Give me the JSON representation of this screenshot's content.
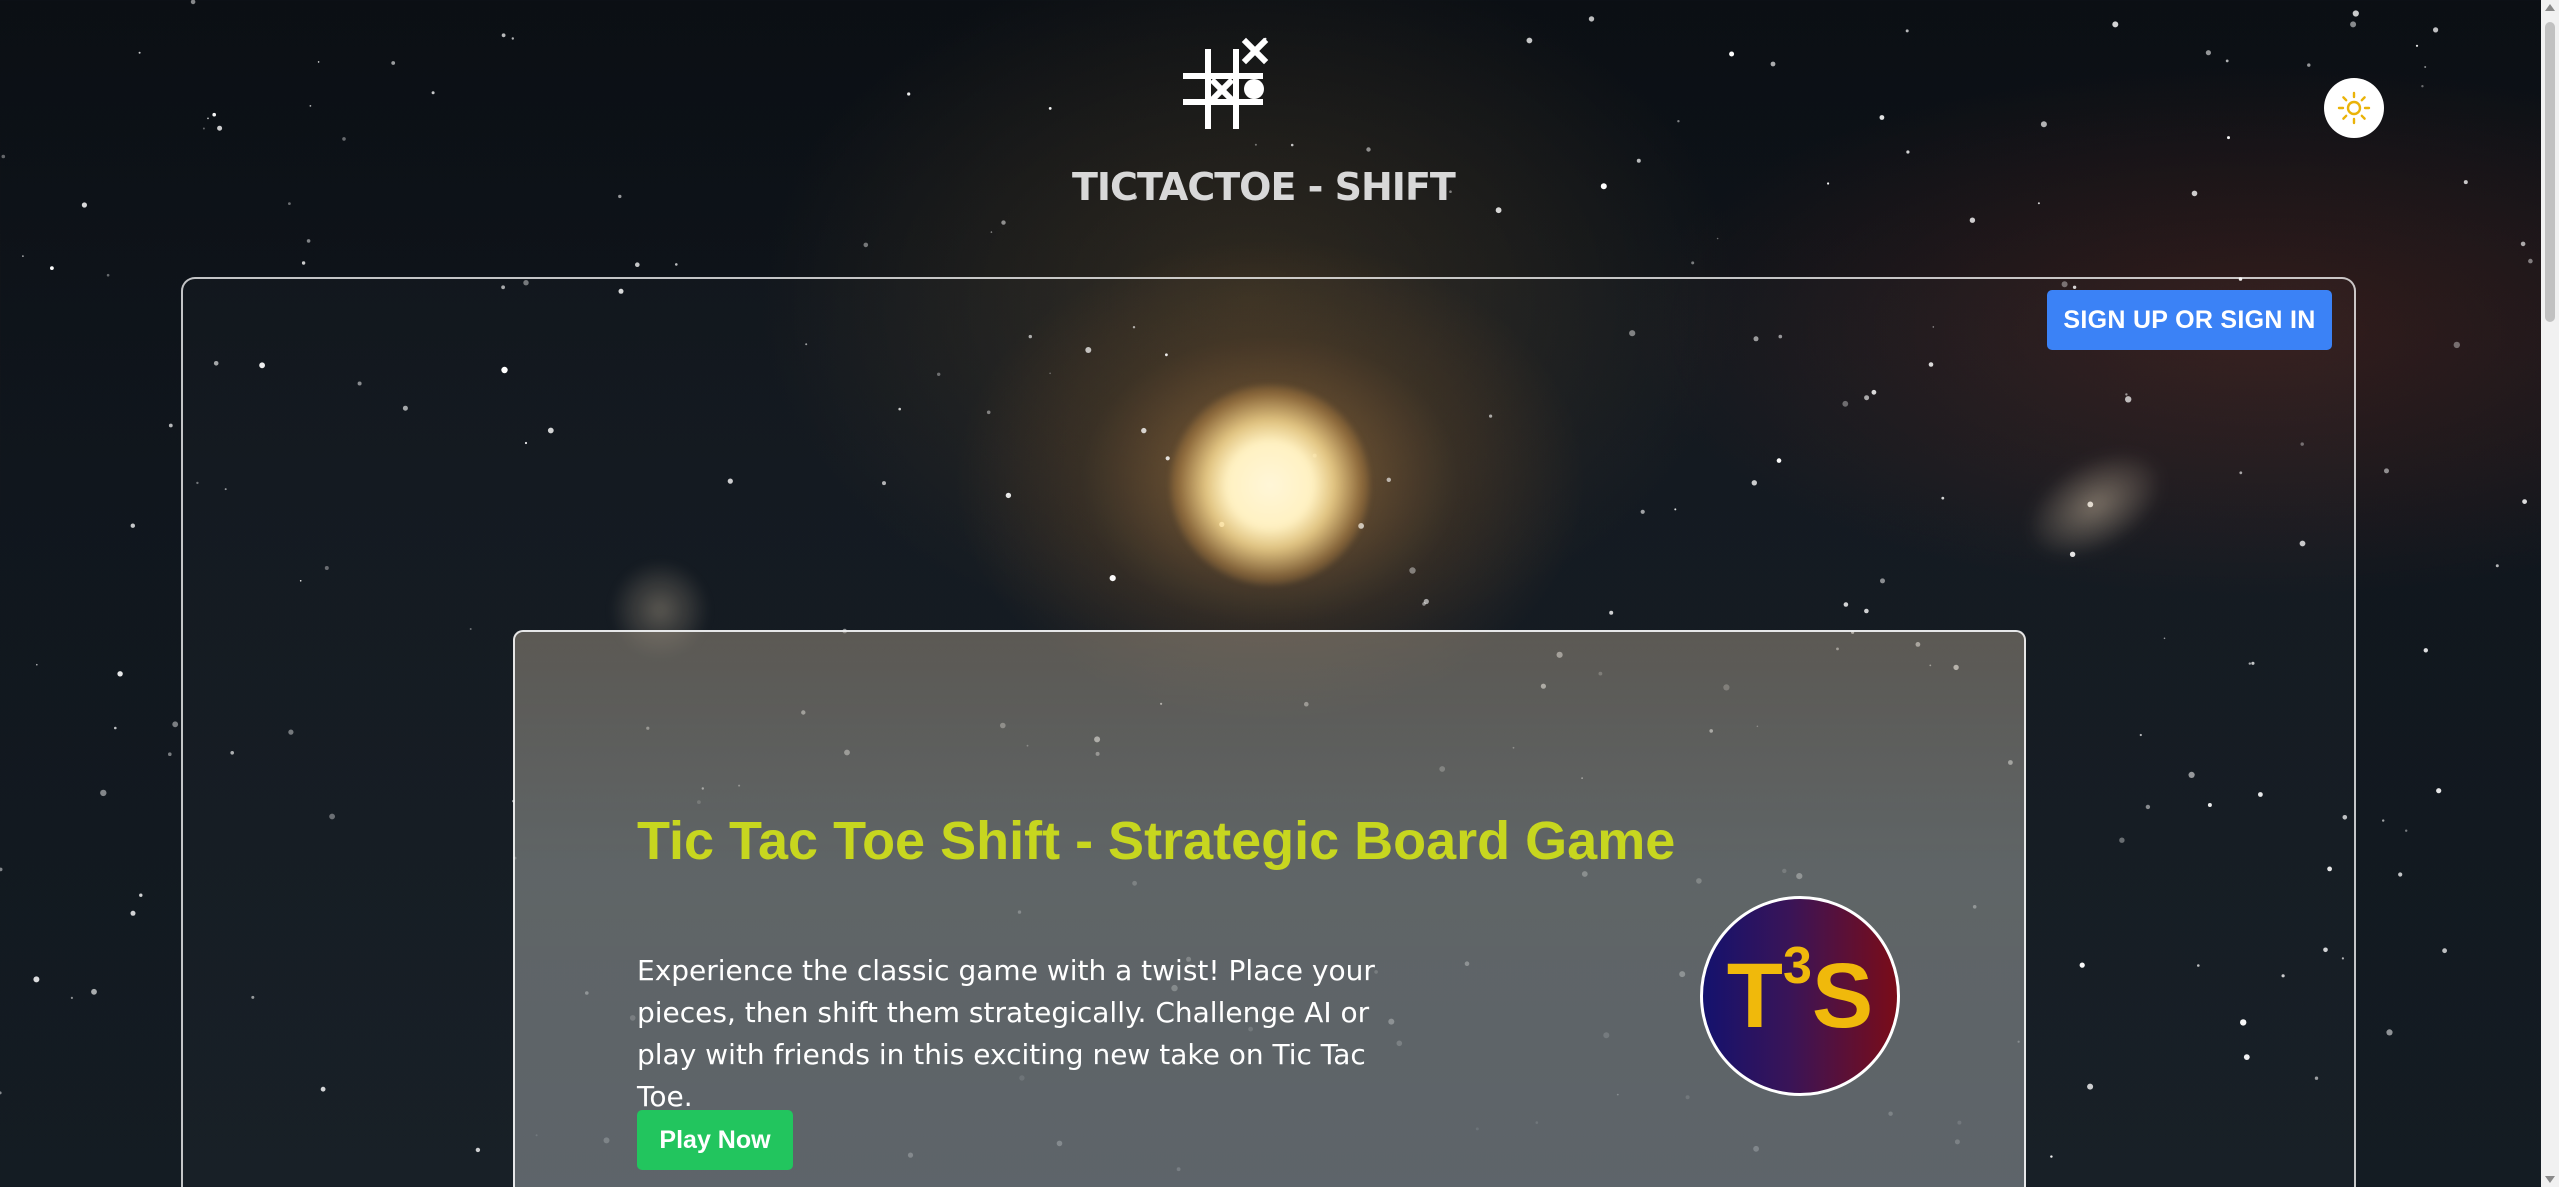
{
  "app": {
    "logo_text": "TICTACTOE - SHIFT",
    "logo_icon": "tictactoe-grid-icon"
  },
  "header": {
    "theme_toggle_icon": "sun-icon",
    "signin_label": "SIGN UP OR SIGN IN"
  },
  "hero": {
    "title": "Tic Tac Toe Shift - Strategic Board Game",
    "description": "Experience the classic game with a twist! Place your pieces, then shift them strategically. Challenge AI or play with friends in this exciting new take on Tic Tac Toe.",
    "play_label": "Play Now",
    "badge": {
      "letter_t": "T",
      "superscript": "3",
      "letter_s": "S"
    }
  },
  "colors": {
    "title_accent": "#c7d61f",
    "signin_button": "#3b82f6",
    "play_button": "#22c55e",
    "badge_text": "#f0b90b",
    "theme_icon": "#eab308"
  }
}
